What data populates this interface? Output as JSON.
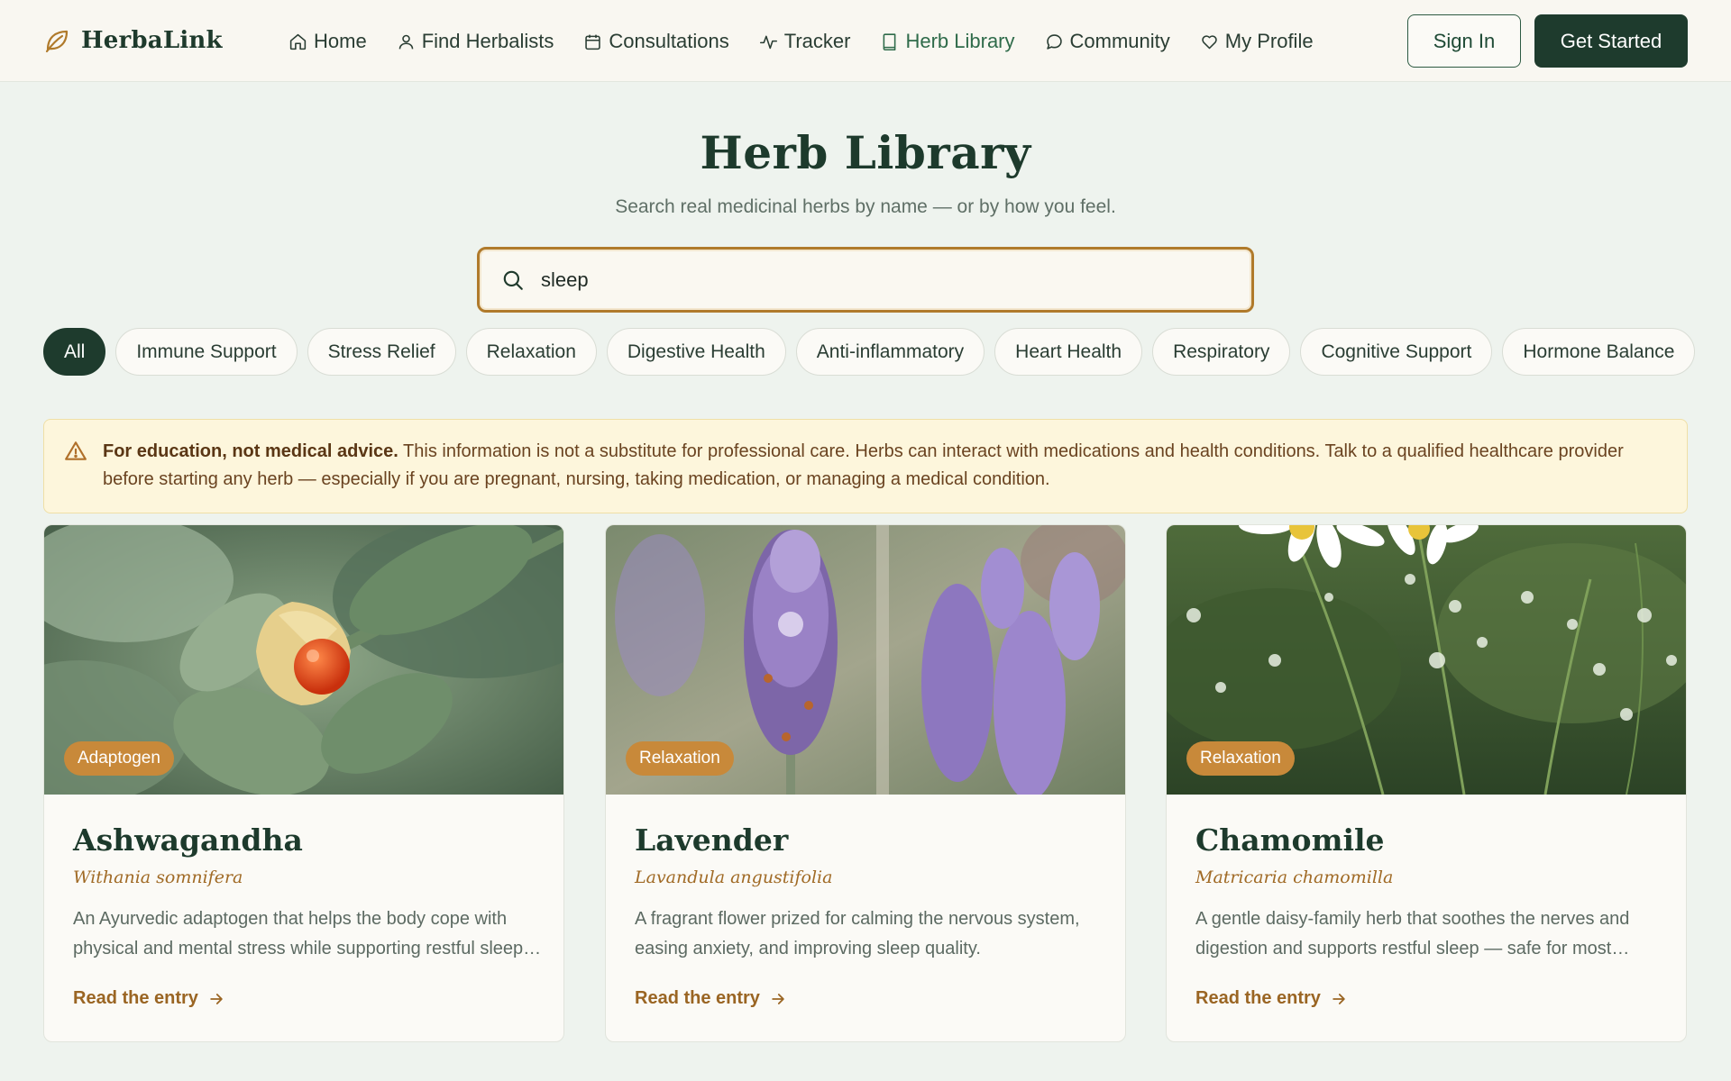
{
  "brand": {
    "name": "HerbaLink",
    "logo_icon": "leaf-icon"
  },
  "nav": {
    "items": [
      {
        "label": "Home",
        "icon": "home-icon"
      },
      {
        "label": "Find Herbalists",
        "icon": "user-icon"
      },
      {
        "label": "Consultations",
        "icon": "calendar-icon"
      },
      {
        "label": "Tracker",
        "icon": "activity-icon"
      },
      {
        "label": "Herb Library",
        "icon": "book-icon",
        "active": true
      },
      {
        "label": "Community",
        "icon": "chat-icon"
      },
      {
        "label": "My Profile",
        "icon": "heart-icon"
      }
    ],
    "signin_label": "Sign In",
    "get_started_label": "Get Started"
  },
  "hero": {
    "title": "Herb Library",
    "subtitle": "Search real medicinal herbs by name — or by how you feel."
  },
  "search": {
    "value": "sleep",
    "placeholder": ""
  },
  "filters": {
    "chips": [
      "All",
      "Immune Support",
      "Stress Relief",
      "Relaxation",
      "Digestive Health",
      "Anti-inflammatory",
      "Heart Health",
      "Respiratory",
      "Cognitive Support",
      "Hormone Balance"
    ],
    "active": "All"
  },
  "disclaimer": {
    "bold": "For education, not medical advice.",
    "text": " This information is not a substitute for professional care. Herbs can interact with medications and health conditions. Talk to a qualified healthcare provider before starting any herb — especially if you are pregnant, nursing, taking medication, or managing a medical condition."
  },
  "cards": [
    {
      "badge": "Adaptogen",
      "name": "Ashwagandha",
      "latin": "Withania somnifera",
      "description": "An Ayurvedic adaptogen that helps the body cope with physical and mental stress while supporting restful sleep and steady energy.",
      "link": "Read the entry"
    },
    {
      "badge": "Relaxation",
      "name": "Lavender",
      "latin": "Lavandula angustifolia",
      "description": "A fragrant flower prized for calming the nervous system, easing anxiety, and improving sleep quality.",
      "link": "Read the entry"
    },
    {
      "badge": "Relaxation",
      "name": "Chamomile",
      "latin": "Matricaria chamomilla",
      "description": "A gentle daisy-family herb that soothes the nerves and digestion and supports restful sleep — safe for most adults.",
      "link": "Read the entry"
    }
  ],
  "colors": {
    "primary": "#1e3b2d",
    "accent": "#c8893a",
    "background": "#eef3ee",
    "warning_bg": "#fdf6dc"
  }
}
